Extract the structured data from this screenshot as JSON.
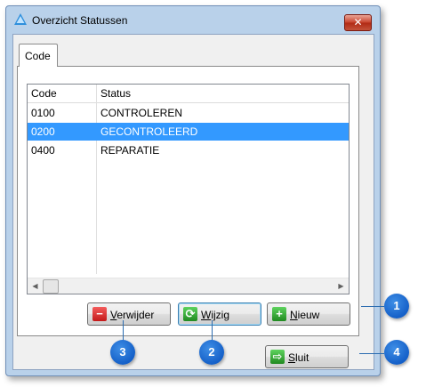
{
  "window": {
    "title": "Overzicht Statussen",
    "close_label": "✕"
  },
  "tab": {
    "label": "Code"
  },
  "list": {
    "columns": [
      "Code",
      "Status"
    ],
    "rows": [
      {
        "code": "0100",
        "status": "CONTROLEREN",
        "selected": false
      },
      {
        "code": "0200",
        "status": "GECONTROLEERD",
        "selected": true
      },
      {
        "code": "0400",
        "status": "REPARATIE",
        "selected": false
      }
    ]
  },
  "buttons": {
    "verwijder": {
      "mnemonic": "V",
      "rest": "erwijder",
      "icon": "minus-icon"
    },
    "wijzig": {
      "mnemonic": "W",
      "rest": "ijzig",
      "icon": "refresh-icon"
    },
    "nieuw": {
      "mnemonic": "N",
      "rest": "ieuw",
      "icon": "plus-icon"
    },
    "sluit": {
      "mnemonic": "S",
      "rest": "luit",
      "icon": "exit-icon"
    }
  },
  "callouts": [
    "1",
    "2",
    "3",
    "4"
  ],
  "colors": {
    "selection": "#3399ff",
    "callout": "#1560c8",
    "window_frame": "#b9d1ea"
  }
}
